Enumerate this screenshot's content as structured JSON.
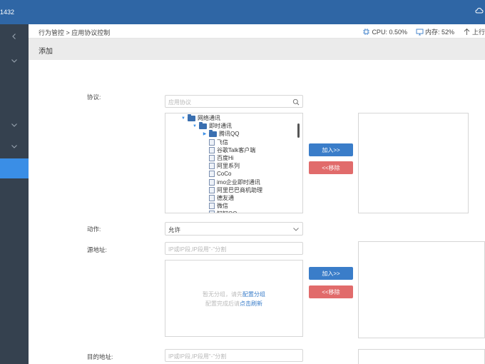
{
  "app": {
    "brand": "1432"
  },
  "breadcrumb": "行为管控 > 应用协议控制",
  "status": {
    "cpu": "CPU: 0.50%",
    "mem": "内存: 52%",
    "up": "上行"
  },
  "page_title": "添加",
  "form": {
    "protocol_label": "协议:",
    "protocol_search_placeholder": "应用协议",
    "tree": [
      {
        "label": "网络通讯",
        "level": 0,
        "type": "folder",
        "expanded": true
      },
      {
        "label": "即时通讯",
        "level": 1,
        "type": "folder",
        "expanded": true
      },
      {
        "label": "腾讯QQ",
        "level": 2,
        "type": "folder",
        "expanded": false
      },
      {
        "label": "飞信",
        "level": 2,
        "type": "doc"
      },
      {
        "label": "谷歌Talk客户端",
        "level": 2,
        "type": "doc"
      },
      {
        "label": "百度Hi",
        "level": 2,
        "type": "doc"
      },
      {
        "label": "阿里系列",
        "level": 2,
        "type": "doc"
      },
      {
        "label": "CoCo",
        "level": 2,
        "type": "doc"
      },
      {
        "label": "imo企业即时通讯",
        "level": 2,
        "type": "doc"
      },
      {
        "label": "阿里巴巴商机助理",
        "level": 2,
        "type": "doc"
      },
      {
        "label": "德友通",
        "level": 2,
        "type": "doc"
      },
      {
        "label": "微信",
        "level": 2,
        "type": "doc"
      },
      {
        "label": "钉钉QQ",
        "level": 2,
        "type": "doc"
      }
    ],
    "add_label": "加入>>",
    "remove_label": "<<移除",
    "action_label": "动作:",
    "action_value": "允许",
    "source_label": "源地址:",
    "source_placeholder": "IP或IP段,IP段用\"-\"分割",
    "group_hint_prefix": "暂无分组，请先",
    "group_hint_link": "配置分组",
    "group_hint2_prefix": "配置完成后请",
    "group_hint2_link": "点击刷新",
    "add_label_2": "加入>>",
    "remove_label_2": "<<移除",
    "dest_label": "目的地址:",
    "dest_placeholder": "IP或IP段,IP段用\"-\"分割"
  }
}
